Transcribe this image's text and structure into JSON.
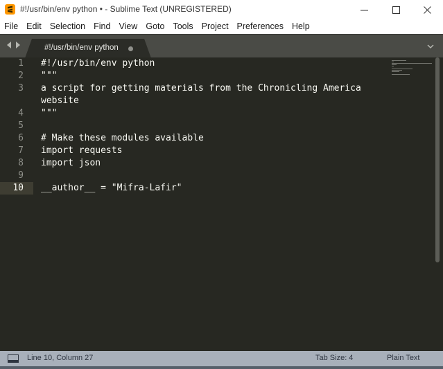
{
  "window": {
    "title": "#!/usr/bin/env python • - Sublime Text (UNREGISTERED)"
  },
  "menu": {
    "items": [
      {
        "label": "File"
      },
      {
        "label": "Edit"
      },
      {
        "label": "Selection"
      },
      {
        "label": "Find"
      },
      {
        "label": "View"
      },
      {
        "label": "Goto"
      },
      {
        "label": "Tools"
      },
      {
        "label": "Project"
      },
      {
        "label": "Preferences"
      },
      {
        "label": "Help"
      }
    ]
  },
  "tabs": [
    {
      "label": "#!/usr/bin/env python",
      "dirty": true,
      "active": true
    }
  ],
  "editor": {
    "current_line": 10,
    "lines": [
      {
        "number": "1",
        "text": "#!/usr/bin/env python"
      },
      {
        "number": "2",
        "text": "\"\"\""
      },
      {
        "number": "3",
        "text": "a script for getting materials from the Chronicling America"
      },
      {
        "number": "",
        "text": "website"
      },
      {
        "number": "4",
        "text": "\"\"\""
      },
      {
        "number": "5",
        "text": ""
      },
      {
        "number": "6",
        "text": "# Make these modules available"
      },
      {
        "number": "7",
        "text": "import requests"
      },
      {
        "number": "8",
        "text": "import json"
      },
      {
        "number": "9",
        "text": ""
      },
      {
        "number": "10",
        "text": "__author__ = \"Mifra-Lafir\""
      }
    ]
  },
  "status": {
    "position": "Line 10, Column 27",
    "tab_size": "Tab Size: 4",
    "syntax": "Plain Text"
  },
  "colors": {
    "editor_bg": "#272822",
    "text": "#f8f8f2",
    "tabbar_bg": "#4a4b46",
    "statusbar_bg": "#a8b0ba",
    "app_icon": "#ff9800"
  },
  "icons": {
    "app": "sublime-text-logo-icon",
    "minimize": "minimize-icon",
    "maximize": "maximize-icon",
    "close": "close-icon",
    "nav_back": "chevron-left-icon",
    "nav_forward": "chevron-right-icon",
    "tab_list": "chevron-down-icon",
    "panel": "panel-toggle-icon"
  }
}
